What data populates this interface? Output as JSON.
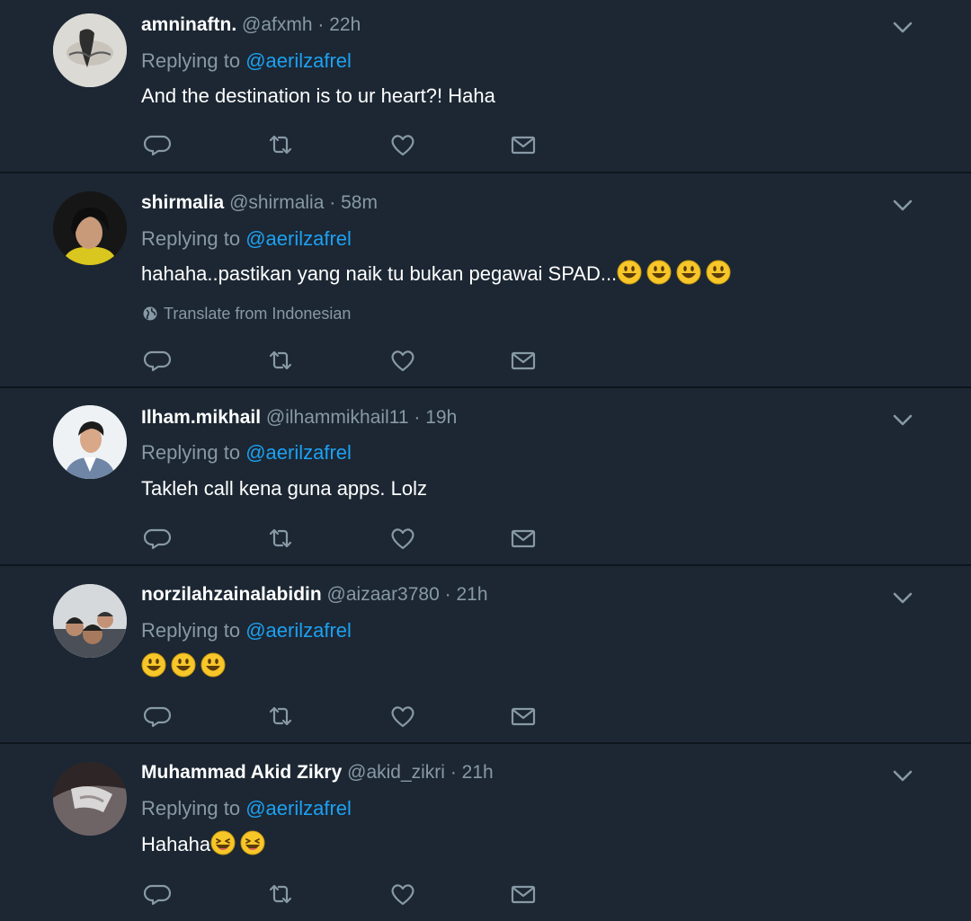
{
  "colors": {
    "background": "#1c2733",
    "divider": "#0e151c",
    "secondary_text": "#8899a6",
    "mention": "#1da1f2",
    "primary_text": "#ffffff",
    "emoji_fill": "#f7c629"
  },
  "tweets": [
    {
      "name": "amninaftn.",
      "handle": "@afxmh",
      "separator": "·",
      "time": "22h",
      "replying_prefix": "Replying to",
      "replying_to": "@aerilzafrel",
      "text": "And the destination is to ur heart?! Haha",
      "emojis": [],
      "translate": null
    },
    {
      "name": "shirmalia",
      "handle": "@shirmalia",
      "separator": "·",
      "time": "58m",
      "replying_prefix": "Replying to",
      "replying_to": "@aerilzafrel",
      "text": "hahaha..pastikan yang naik tu bukan pegawai SPAD...",
      "emojis": [
        "grinning-face",
        "grinning-face",
        "grinning-face",
        "grinning-face"
      ],
      "translate": "Translate from Indonesian"
    },
    {
      "name": "Ilham.mikhail",
      "handle": "@ilhammikhail11",
      "separator": "·",
      "time": "19h",
      "replying_prefix": "Replying to",
      "replying_to": "@aerilzafrel",
      "text": "Takleh call kena guna apps. Lolz",
      "emojis": [],
      "translate": null
    },
    {
      "name": "norzilahzainalabidin",
      "handle": "@aizaar3780",
      "separator": "·",
      "time": "21h",
      "replying_prefix": "Replying to",
      "replying_to": "@aerilzafrel",
      "text": "",
      "emojis": [
        "grinning-face",
        "grinning-face",
        "grinning-face"
      ],
      "translate": null
    },
    {
      "name": "Muhammad Akid Zikry",
      "handle": "@akid_zikri",
      "separator": "·",
      "time": "21h",
      "replying_prefix": "Replying to",
      "replying_to": "@aerilzafrel",
      "text": "Hahaha",
      "emojis": [
        "laughing-face",
        "laughing-face"
      ],
      "translate": null
    }
  ],
  "icons": {
    "reply": "reply-icon",
    "retweet": "retweet-icon",
    "like": "heart-icon",
    "dm": "envelope-icon",
    "caret": "chevron-down-icon",
    "translate": "globe-icon"
  }
}
